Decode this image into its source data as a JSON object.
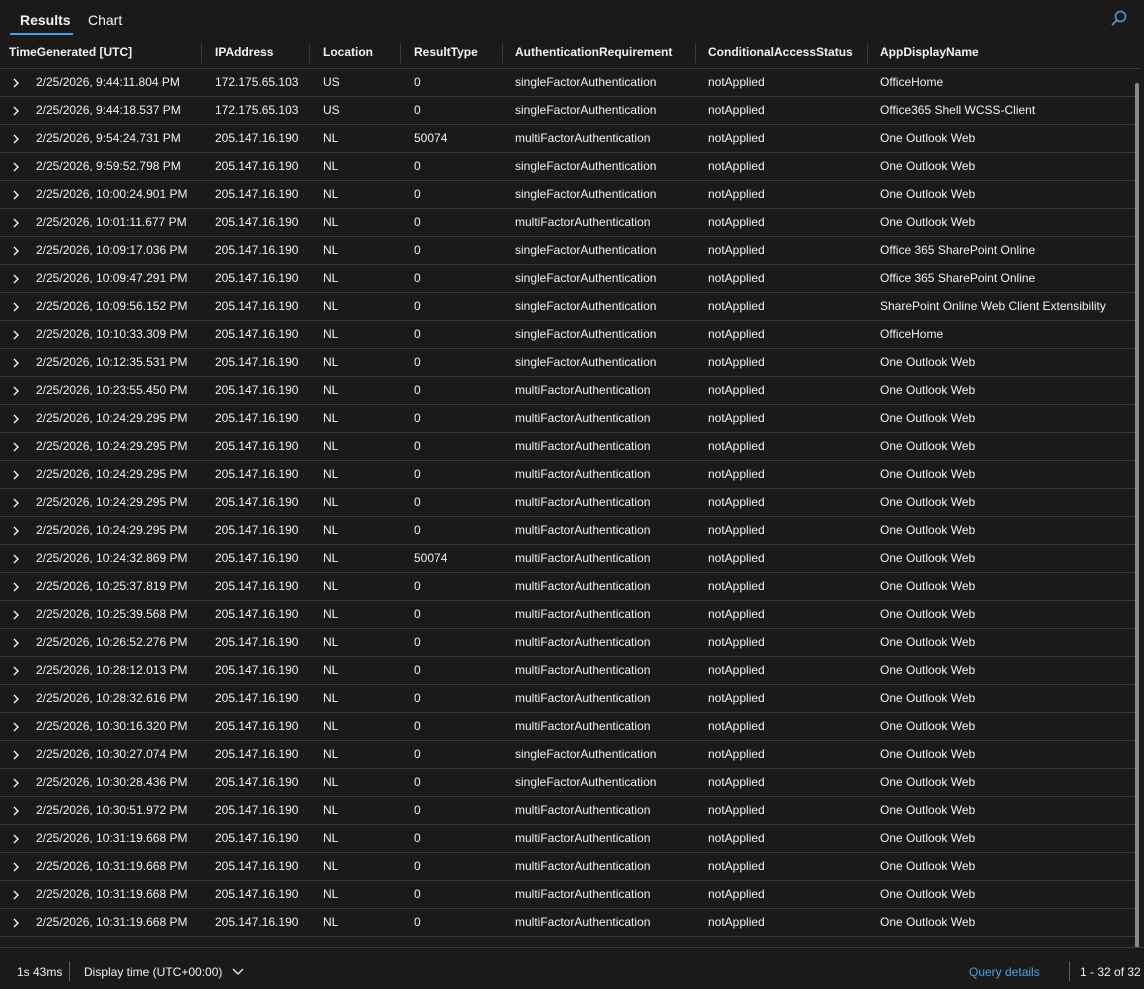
{
  "tabs": {
    "results": "Results",
    "chart": "Chart"
  },
  "columns": [
    "TimeGenerated [UTC]",
    "IPAddress",
    "Location",
    "ResultType",
    "AuthenticationRequirement",
    "ConditionalAccessStatus",
    "AppDisplayName"
  ],
  "rows": [
    [
      "2/25/2026, 9:44:11.804 PM",
      "172.175.65.103",
      "US",
      "0",
      "singleFactorAuthentication",
      "notApplied",
      "OfficeHome"
    ],
    [
      "2/25/2026, 9:44:18.537 PM",
      "172.175.65.103",
      "US",
      "0",
      "singleFactorAuthentication",
      "notApplied",
      "Office365 Shell WCSS-Client"
    ],
    [
      "2/25/2026, 9:54:24.731 PM",
      "205.147.16.190",
      "NL",
      "50074",
      "multiFactorAuthentication",
      "notApplied",
      "One Outlook Web"
    ],
    [
      "2/25/2026, 9:59:52.798 PM",
      "205.147.16.190",
      "NL",
      "0",
      "singleFactorAuthentication",
      "notApplied",
      "One Outlook Web"
    ],
    [
      "2/25/2026, 10:00:24.901 PM",
      "205.147.16.190",
      "NL",
      "0",
      "singleFactorAuthentication",
      "notApplied",
      "One Outlook Web"
    ],
    [
      "2/25/2026, 10:01:11.677 PM",
      "205.147.16.190",
      "NL",
      "0",
      "multiFactorAuthentication",
      "notApplied",
      "One Outlook Web"
    ],
    [
      "2/25/2026, 10:09:17.036 PM",
      "205.147.16.190",
      "NL",
      "0",
      "singleFactorAuthentication",
      "notApplied",
      "Office 365 SharePoint Online"
    ],
    [
      "2/25/2026, 10:09:47.291 PM",
      "205.147.16.190",
      "NL",
      "0",
      "singleFactorAuthentication",
      "notApplied",
      "Office 365 SharePoint Online"
    ],
    [
      "2/25/2026, 10:09:56.152 PM",
      "205.147.16.190",
      "NL",
      "0",
      "singleFactorAuthentication",
      "notApplied",
      "SharePoint Online Web Client Extensibility"
    ],
    [
      "2/25/2026, 10:10:33.309 PM",
      "205.147.16.190",
      "NL",
      "0",
      "singleFactorAuthentication",
      "notApplied",
      "OfficeHome"
    ],
    [
      "2/25/2026, 10:12:35.531 PM",
      "205.147.16.190",
      "NL",
      "0",
      "singleFactorAuthentication",
      "notApplied",
      "One Outlook Web"
    ],
    [
      "2/25/2026, 10:23:55.450 PM",
      "205.147.16.190",
      "NL",
      "0",
      "multiFactorAuthentication",
      "notApplied",
      "One Outlook Web"
    ],
    [
      "2/25/2026, 10:24:29.295 PM",
      "205.147.16.190",
      "NL",
      "0",
      "multiFactorAuthentication",
      "notApplied",
      "One Outlook Web"
    ],
    [
      "2/25/2026, 10:24:29.295 PM",
      "205.147.16.190",
      "NL",
      "0",
      "multiFactorAuthentication",
      "notApplied",
      "One Outlook Web"
    ],
    [
      "2/25/2026, 10:24:29.295 PM",
      "205.147.16.190",
      "NL",
      "0",
      "multiFactorAuthentication",
      "notApplied",
      "One Outlook Web"
    ],
    [
      "2/25/2026, 10:24:29.295 PM",
      "205.147.16.190",
      "NL",
      "0",
      "multiFactorAuthentication",
      "notApplied",
      "One Outlook Web"
    ],
    [
      "2/25/2026, 10:24:29.295 PM",
      "205.147.16.190",
      "NL",
      "0",
      "multiFactorAuthentication",
      "notApplied",
      "One Outlook Web"
    ],
    [
      "2/25/2026, 10:24:32.869 PM",
      "205.147.16.190",
      "NL",
      "50074",
      "multiFactorAuthentication",
      "notApplied",
      "One Outlook Web"
    ],
    [
      "2/25/2026, 10:25:37.819 PM",
      "205.147.16.190",
      "NL",
      "0",
      "multiFactorAuthentication",
      "notApplied",
      "One Outlook Web"
    ],
    [
      "2/25/2026, 10:25:39.568 PM",
      "205.147.16.190",
      "NL",
      "0",
      "multiFactorAuthentication",
      "notApplied",
      "One Outlook Web"
    ],
    [
      "2/25/2026, 10:26:52.276 PM",
      "205.147.16.190",
      "NL",
      "0",
      "multiFactorAuthentication",
      "notApplied",
      "One Outlook Web"
    ],
    [
      "2/25/2026, 10:28:12.013 PM",
      "205.147.16.190",
      "NL",
      "0",
      "multiFactorAuthentication",
      "notApplied",
      "One Outlook Web"
    ],
    [
      "2/25/2026, 10:28:32.616 PM",
      "205.147.16.190",
      "NL",
      "0",
      "multiFactorAuthentication",
      "notApplied",
      "One Outlook Web"
    ],
    [
      "2/25/2026, 10:30:16.320 PM",
      "205.147.16.190",
      "NL",
      "0",
      "multiFactorAuthentication",
      "notApplied",
      "One Outlook Web"
    ],
    [
      "2/25/2026, 10:30:27.074 PM",
      "205.147.16.190",
      "NL",
      "0",
      "singleFactorAuthentication",
      "notApplied",
      "One Outlook Web"
    ],
    [
      "2/25/2026, 10:30:28.436 PM",
      "205.147.16.190",
      "NL",
      "0",
      "singleFactorAuthentication",
      "notApplied",
      "One Outlook Web"
    ],
    [
      "2/25/2026, 10:30:51.972 PM",
      "205.147.16.190",
      "NL",
      "0",
      "multiFactorAuthentication",
      "notApplied",
      "One Outlook Web"
    ],
    [
      "2/25/2026, 10:31:19.668 PM",
      "205.147.16.190",
      "NL",
      "0",
      "multiFactorAuthentication",
      "notApplied",
      "One Outlook Web"
    ],
    [
      "2/25/2026, 10:31:19.668 PM",
      "205.147.16.190",
      "NL",
      "0",
      "multiFactorAuthentication",
      "notApplied",
      "One Outlook Web"
    ],
    [
      "2/25/2026, 10:31:19.668 PM",
      "205.147.16.190",
      "NL",
      "0",
      "multiFactorAuthentication",
      "notApplied",
      "One Outlook Web"
    ],
    [
      "2/25/2026, 10:31:19.668 PM",
      "205.147.16.190",
      "NL",
      "0",
      "multiFactorAuthentication",
      "notApplied",
      "One Outlook Web"
    ]
  ],
  "footer": {
    "duration": "1s 43ms",
    "display_time": "Display time (UTC+00:00)",
    "query_details": "Query details",
    "pagination": "1 - 32 of 32"
  },
  "icons": {
    "search": "search-icon",
    "expand": "chevron-right-icon",
    "dropdown": "chevron-down-icon"
  },
  "colors": {
    "background": "#1b1a19",
    "accent": "#4ca0e6",
    "text": "#f3f2f1",
    "border": "#3b3a39"
  }
}
